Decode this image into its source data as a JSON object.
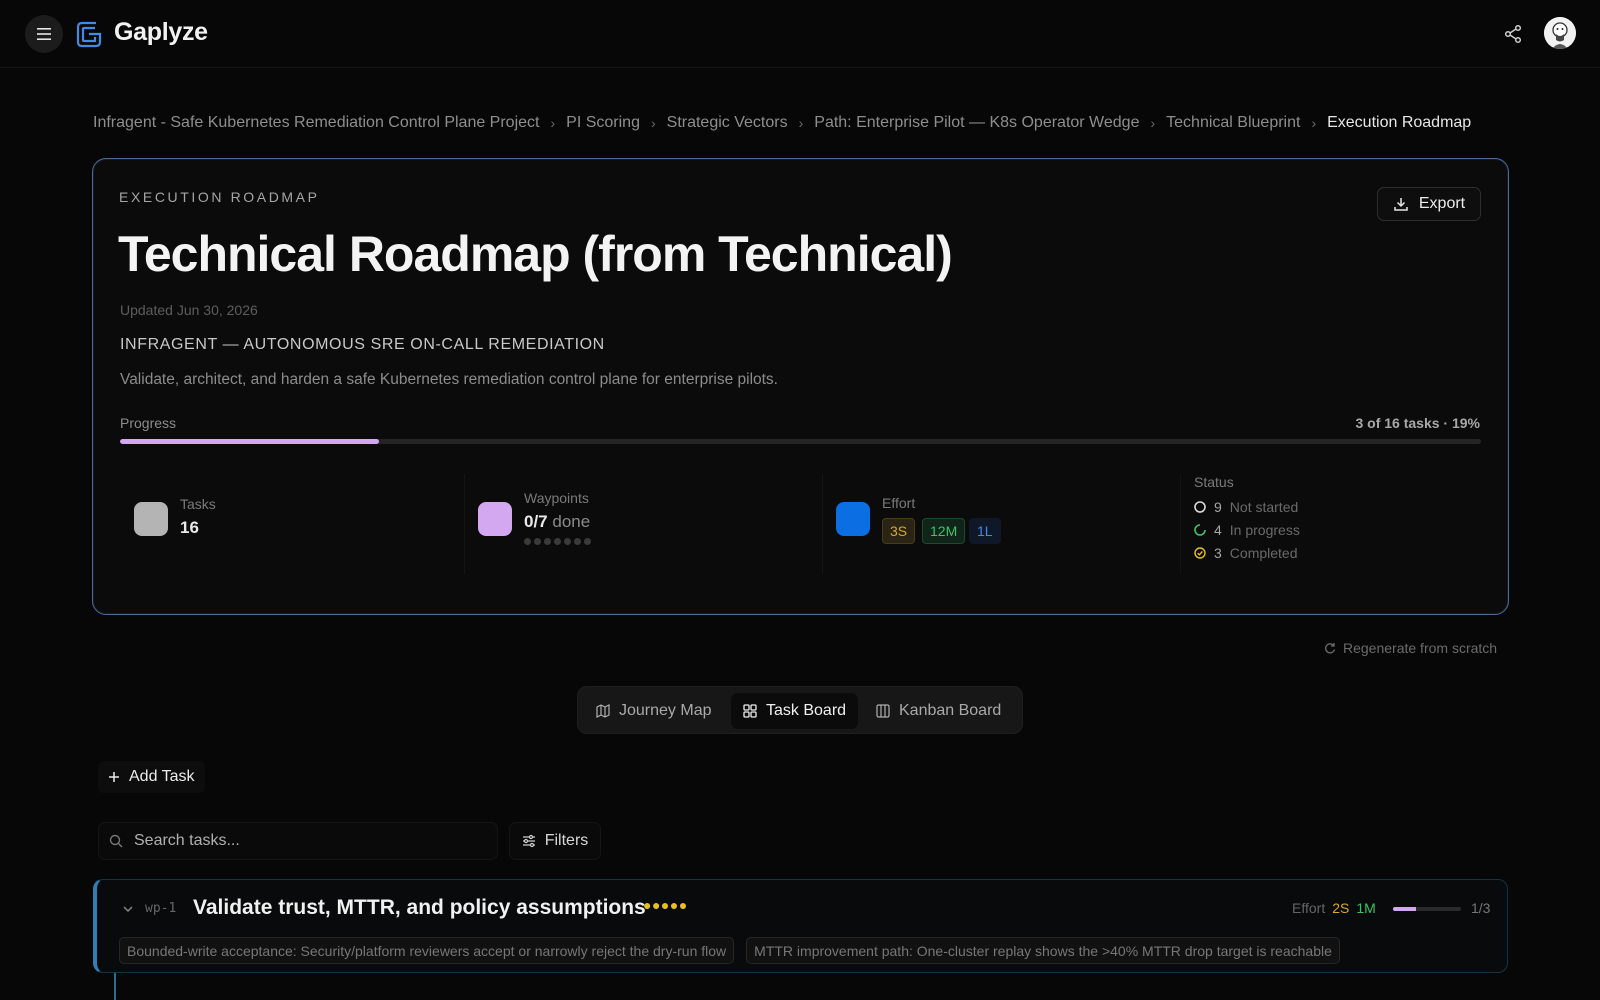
{
  "app": {
    "name": "Gaplyze"
  },
  "breadcrumb": [
    "Infragent - Safe Kubernetes Remediation Control Plane Project",
    "PI Scoring",
    "Strategic Vectors",
    "Path: Enterprise Pilot — K8s Operator Wedge",
    "Technical Blueprint",
    "Execution Roadmap"
  ],
  "roadmap": {
    "eyebrow": "EXECUTION ROADMAP",
    "export_label": "Export",
    "title": "Technical Roadmap (from Technical)",
    "updated": "Updated Jun 30, 2026",
    "subtitle": "INFRAGENT — AUTONOMOUS SRE ON-CALL REMEDIATION",
    "description": "Validate, architect, and harden a safe Kubernetes remediation control plane for enterprise pilots.",
    "progress_label": "Progress",
    "progress_text": "3 of 16 tasks · 19%",
    "progress_fraction": 0.19,
    "accent_color": "#d3a8f0"
  },
  "stats": {
    "tasks": {
      "label": "Tasks",
      "value": "16",
      "color": "#b4b4b4"
    },
    "waypoints": {
      "label": "Waypoints",
      "value": "0/7",
      "suffix": "done",
      "total": 7,
      "completed": 0,
      "color": "#d3a8f0"
    },
    "effort": {
      "label": "Effort",
      "color": "#0b6fe3",
      "pills": [
        {
          "text": "3S",
          "color": "#d9a630",
          "bg": "#2a2414",
          "border": "#4a3c18"
        },
        {
          "text": "12M",
          "color": "#3cc26a",
          "bg": "#102419",
          "border": "#1c4a2d"
        },
        {
          "text": "1L",
          "color": "#3f8be6",
          "bg": "#0f1828",
          "border": "#0f1828"
        }
      ]
    },
    "status": {
      "label": "Status",
      "items": [
        {
          "count": "9",
          "label": "Not started",
          "icon": "circle-icon"
        },
        {
          "count": "4",
          "label": "In progress",
          "icon": "loader-icon"
        },
        {
          "count": "3",
          "label": "Completed",
          "icon": "check-circle-icon"
        }
      ]
    }
  },
  "regenerate_label": "Regenerate from scratch",
  "tabs": [
    {
      "label": "Journey Map",
      "icon": "map-icon",
      "active": false
    },
    {
      "label": "Task Board",
      "icon": "grid-icon",
      "active": true
    },
    {
      "label": "Kanban Board",
      "icon": "columns-icon",
      "active": false
    }
  ],
  "toolbar": {
    "add_task_label": "Add Task",
    "search_placeholder": "Search tasks...",
    "filters_label": "Filters"
  },
  "waypoint": {
    "id": "wp-1",
    "title": "Validate trust, MTTR, and policy assumptions",
    "priority_dots": "●●●●●",
    "effort_label": "Effort",
    "effort_s": "2S",
    "effort_m": "1M",
    "progress_fraction": 0.333,
    "count": "1/3",
    "chips": [
      "Bounded-write acceptance: Security/platform reviewers accept or narrowly reject the dry-run flow",
      "MTTR improvement path: One-cluster replay shows the >40% MTTR drop target is reachable"
    ]
  }
}
